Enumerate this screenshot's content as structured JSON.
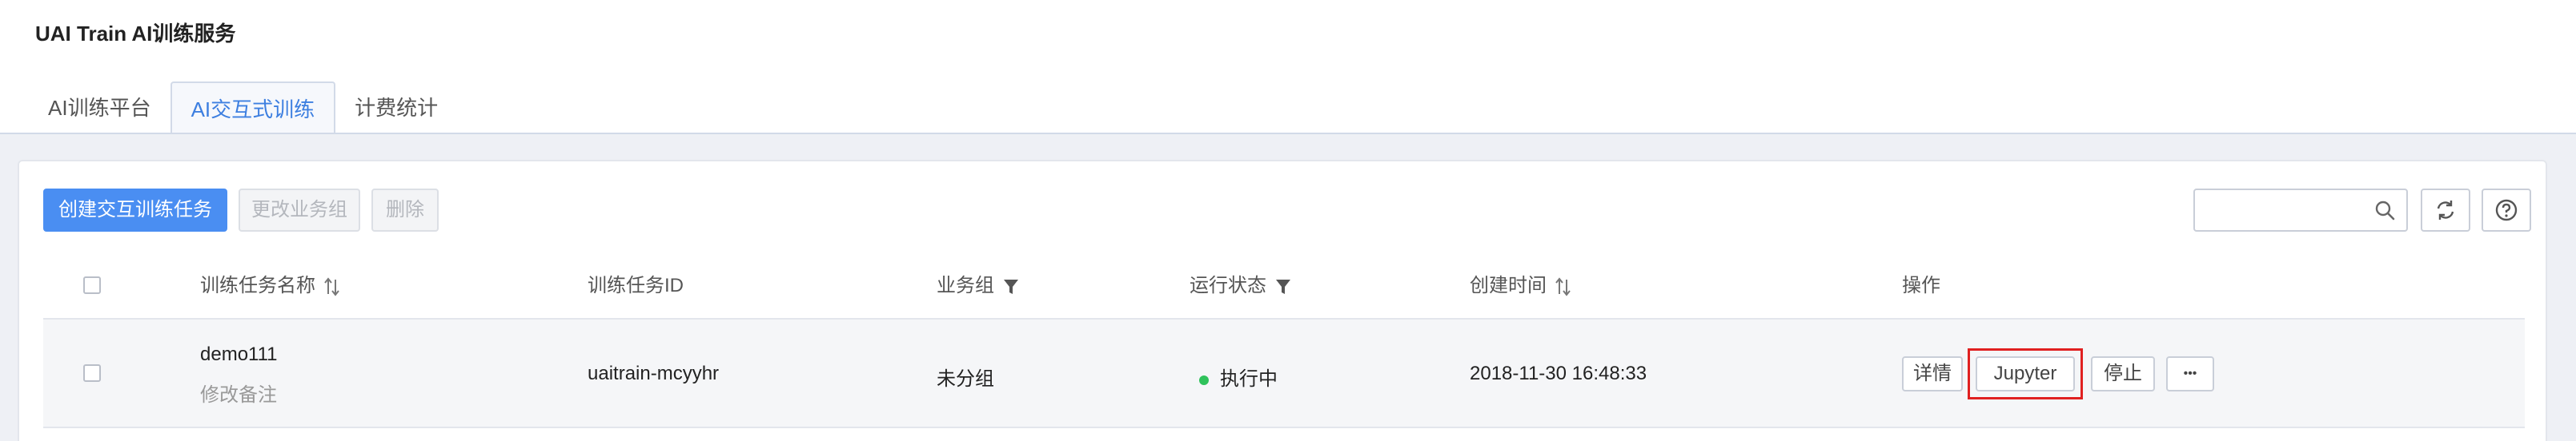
{
  "header": {
    "title": "UAI Train AI训练服务"
  },
  "tabs": [
    {
      "label": "AI训练平台",
      "active": false
    },
    {
      "label": "AI交互式训练",
      "active": true
    },
    {
      "label": "计费统计",
      "active": false
    }
  ],
  "toolbar": {
    "create_label": "创建交互训练任务",
    "change_group_label": "更改业务组",
    "delete_label": "删除",
    "search_placeholder": ""
  },
  "table": {
    "columns": [
      {
        "label": "训练任务名称",
        "icon": "sort-icon"
      },
      {
        "label": "训练任务ID",
        "icon": ""
      },
      {
        "label": "业务组",
        "icon": "filter-icon"
      },
      {
        "label": "运行状态",
        "icon": "filter-icon"
      },
      {
        "label": "创建时间",
        "icon": "sort-icon"
      },
      {
        "label": "操作",
        "icon": ""
      }
    ],
    "rows": [
      {
        "name": "demo111",
        "remark_link": "修改备注",
        "id": "uaitrain-mcyyhr",
        "group": "未分组",
        "status": "执行中",
        "status_color": "#2fc25b",
        "created": "2018-11-30 16:48:33",
        "actions": {
          "detail": "详情",
          "jupyter": "Jupyter",
          "stop": "停止",
          "more": "•••"
        }
      }
    ]
  },
  "colors": {
    "primary": "#4a8ef2",
    "active_tab": "#3d7fe0",
    "highlight": "#e02020",
    "running": "#2fc25b"
  }
}
